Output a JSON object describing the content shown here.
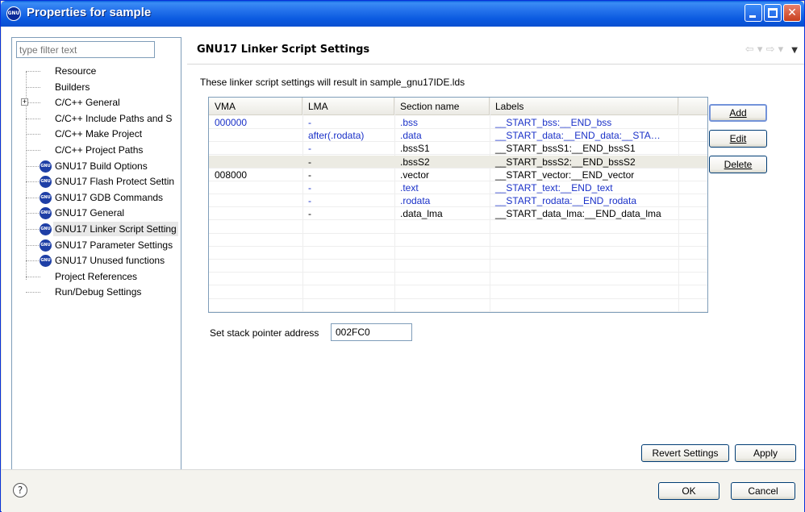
{
  "window": {
    "title": "Properties for sample",
    "icon_text": "GNU",
    "controls": [
      "minimize-icon",
      "maximize-icon",
      "close-icon"
    ]
  },
  "sidebar": {
    "filter_placeholder": "type filter text",
    "items": [
      {
        "label": "Resource",
        "icon": "none",
        "expandable": false
      },
      {
        "label": "Builders",
        "icon": "none",
        "expandable": false
      },
      {
        "label": "C/C++ General",
        "icon": "none",
        "expandable": true
      },
      {
        "label": "C/C++ Include Paths and S",
        "icon": "none",
        "expandable": false
      },
      {
        "label": "C/C++ Make Project",
        "icon": "none",
        "expandable": false
      },
      {
        "label": "C/C++ Project Paths",
        "icon": "none",
        "expandable": false
      },
      {
        "label": "GNU17 Build Options",
        "icon": "gnu-icon",
        "expandable": false
      },
      {
        "label": "GNU17 Flash Protect Settin",
        "icon": "gnu-icon",
        "expandable": false
      },
      {
        "label": "GNU17 GDB Commands",
        "icon": "gnu-icon",
        "expandable": false
      },
      {
        "label": "GNU17 General",
        "icon": "gnu-icon",
        "expandable": false
      },
      {
        "label": "GNU17 Linker Script Setting",
        "icon": "gnu-icon",
        "expandable": false,
        "selected": true
      },
      {
        "label": "GNU17 Parameter Settings",
        "icon": "gnu-icon",
        "expandable": false
      },
      {
        "label": "GNU17 Unused functions",
        "icon": "gnu-icon",
        "expandable": false
      },
      {
        "label": "Project References",
        "icon": "none",
        "expandable": false
      },
      {
        "label": "Run/Debug Settings",
        "icon": "none",
        "expandable": false
      }
    ]
  },
  "main": {
    "title": "GNU17 Linker Script Settings",
    "description": "These linker script settings will result in sample_gnu17IDE.lds",
    "table": {
      "columns": [
        "VMA",
        "LMA",
        "Section name",
        "Labels"
      ],
      "rows": [
        {
          "vma": "000000",
          "lma": "-",
          "section": ".bss",
          "labels": "__START_bss:__END_bss",
          "blue": true,
          "highlight": false
        },
        {
          "vma": "",
          "lma": "after(.rodata)",
          "section": ".data",
          "labels": "__START_data:__END_data:__STA…",
          "blue": true,
          "highlight": false
        },
        {
          "vma": "",
          "lma": "-",
          "section": ".bssS1",
          "labels": "__START_bssS1:__END_bssS1",
          "blue": false,
          "highlight": false
        },
        {
          "vma": "",
          "lma": "-",
          "section": ".bssS2",
          "labels": "__START_bssS2:__END_bssS2",
          "blue": false,
          "highlight": true
        },
        {
          "vma": "008000",
          "lma": "-",
          "section": ".vector",
          "labels": "__START_vector:__END_vector",
          "blue": false,
          "highlight": false
        },
        {
          "vma": "",
          "lma": "-",
          "section": ".text",
          "labels": "__START_text:__END_text",
          "blue": true,
          "highlight": false
        },
        {
          "vma": "",
          "lma": "-",
          "section": ".rodata",
          "labels": "__START_rodata:__END_rodata",
          "blue": true,
          "highlight": false
        },
        {
          "vma": "",
          "lma": "-",
          "section": ".data_lma",
          "labels": "__START_data_lma:__END_data_lma",
          "blue": false,
          "highlight": false
        }
      ]
    },
    "buttons": {
      "add": "Add",
      "edit": "Edit",
      "delete": "Delete"
    },
    "stack_pointer_label": "Set stack pointer address",
    "stack_pointer_value": "002FC0",
    "revert": "Revert Settings",
    "apply": "Apply"
  },
  "footer": {
    "ok": "OK",
    "cancel": "Cancel"
  },
  "colors": {
    "title_bar": "#0a5fdd",
    "link_blue": "#1a31c8",
    "highlight_row": "#ecebe3"
  }
}
